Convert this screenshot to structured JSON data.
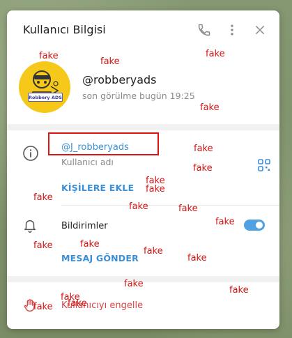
{
  "header": {
    "title": "Kullanıcı Bilgisi"
  },
  "icons": {
    "phone": "phone-icon",
    "more": "more-vertical-icon",
    "close": "close-icon",
    "info": "info-icon",
    "qr": "qr-code-icon",
    "bell": "bell-icon",
    "block": "hand-block-icon"
  },
  "profile": {
    "avatar_badge": "Robbery ADS",
    "username": "@robberyads",
    "last_seen": "son görülme bugün 19:25"
  },
  "info": {
    "handle": "@J_robberyads",
    "handle_label": "Kullanıcı adı",
    "add_contact": "KİŞİLERE EKLE"
  },
  "notifications": {
    "label": "Bildirimler",
    "enabled": true,
    "send_message": "MESAJ GÖNDER"
  },
  "block": {
    "label": "Kullanıcıyı engelle"
  },
  "colors": {
    "accent": "#3a8fd6",
    "danger": "#d64545",
    "watermark": "#d11515",
    "avatar_bg": "#f6c81a"
  },
  "watermark": {
    "fake_marks": [
      "fake",
      "fake",
      "fake",
      "fake",
      "fake",
      "fake",
      "fake",
      "fake",
      "fake",
      "fake",
      "fake",
      "fake",
      "fake",
      "fake",
      "fake",
      "fake",
      "fake",
      "fake",
      "fake",
      "fake",
      "fake",
      "fake",
      "fake"
    ]
  }
}
